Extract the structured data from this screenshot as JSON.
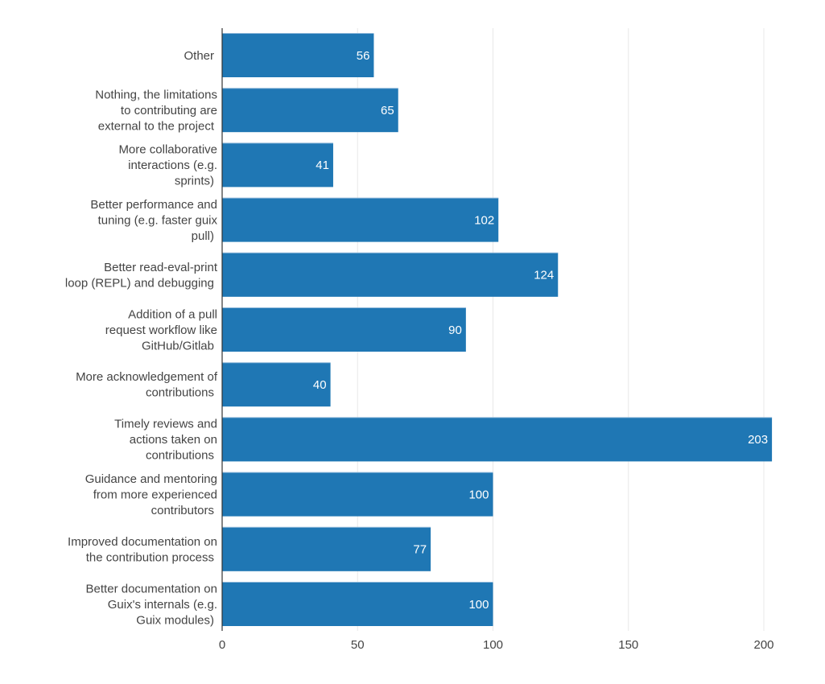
{
  "chart_data": {
    "type": "bar",
    "orientation": "horizontal",
    "title": "",
    "xlabel": "",
    "ylabel": "",
    "xlim": [
      0,
      200
    ],
    "xticks": [
      0,
      50,
      100,
      150,
      200
    ],
    "grid": true,
    "bar_color": "#1f77b4",
    "data_label_color": "#ffffff",
    "categories": [
      [
        "Other"
      ],
      [
        "Nothing, the limitations",
        "to contributing are",
        "external to the project"
      ],
      [
        "More collaborative",
        "interactions (e.g.",
        "sprints)"
      ],
      [
        "Better performance and",
        "tuning (e.g. faster guix",
        "pull)"
      ],
      [
        "Better read-eval-print",
        "loop (REPL) and debugging"
      ],
      [
        "Addition of a pull",
        "request workflow like",
        "GitHub/Gitlab"
      ],
      [
        "More acknowledgement of",
        "contributions"
      ],
      [
        "Timely reviews and",
        "actions taken on",
        "contributions"
      ],
      [
        "Guidance and mentoring",
        "from more experienced",
        "contributors"
      ],
      [
        "Improved documentation on",
        "the contribution process"
      ],
      [
        "Better documentation on",
        "Guix's internals (e.g.",
        "Guix modules)"
      ]
    ],
    "values": [
      56,
      65,
      41,
      102,
      124,
      90,
      40,
      203,
      100,
      77,
      100
    ]
  }
}
